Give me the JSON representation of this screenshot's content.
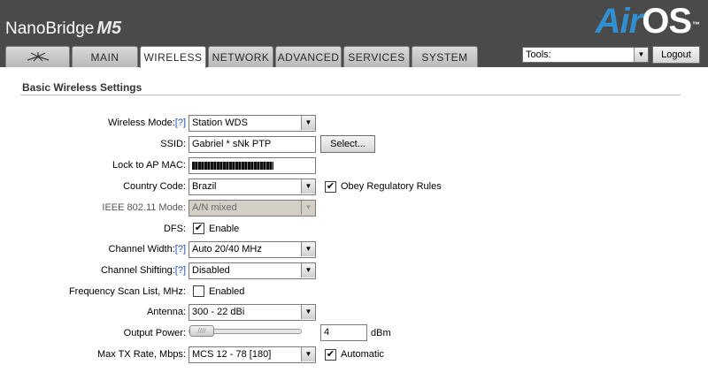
{
  "header": {
    "brand_name": "NanoBridge",
    "brand_model": "M5",
    "logo_air": "Air",
    "logo_os": "OS",
    "logo_tm": "™"
  },
  "tabs": [
    {
      "label": "",
      "icon": "ubiquiti-logo-icon",
      "active": false
    },
    {
      "label": "MAIN",
      "active": false
    },
    {
      "label": "WIRELESS",
      "active": true
    },
    {
      "label": "NETWORK",
      "active": false
    },
    {
      "label": "ADVANCED",
      "active": false
    },
    {
      "label": "SERVICES",
      "active": false
    },
    {
      "label": "SYSTEM",
      "active": false
    }
  ],
  "toolbar": {
    "tools_value": "Tools:",
    "logout_label": "Logout"
  },
  "section": {
    "title": "Basic Wireless Settings"
  },
  "form": {
    "wireless_mode": {
      "label": "Wireless Mode:",
      "help": "[?]",
      "value": "Station WDS"
    },
    "ssid": {
      "label": "SSID:",
      "value": "Gabriel * sNk PTP",
      "select_label": "Select..."
    },
    "lock_ap_mac": {
      "label": "Lock to AP MAC:"
    },
    "country_code": {
      "label": "Country Code:",
      "value": "Brazil",
      "obey_label": "Obey Regulatory Rules",
      "obey_checked": true
    },
    "ieee_mode": {
      "label": "IEEE 802.11 Mode:",
      "value": "A/N mixed"
    },
    "dfs": {
      "label": "DFS:",
      "enable_label": "Enable",
      "checked": true
    },
    "channel_width": {
      "label": "Channel Width:",
      "help": "[?]",
      "value": "Auto 20/40 MHz"
    },
    "channel_shifting": {
      "label": "Channel Shifting:",
      "help": "[?]",
      "value": "Disabled"
    },
    "freq_scan": {
      "label": "Frequency Scan List, MHz:",
      "enabled_label": "Enabled",
      "checked": false
    },
    "antenna": {
      "label": "Antenna:",
      "value": "300 - 22 dBi"
    },
    "output_power": {
      "label": "Output Power:",
      "value": "4",
      "unit": "dBm",
      "slider_fraction": 0.0
    },
    "max_tx_rate": {
      "label": "Max TX Rate, Mbps:",
      "value": "MCS 12 - 78 [180]",
      "automatic_label": "Automatic",
      "automatic_checked": true
    }
  },
  "colors": {
    "header_bg": "#4a4a4a",
    "logo_accent": "#2f8fcf",
    "help_link": "#1a4fb5"
  }
}
